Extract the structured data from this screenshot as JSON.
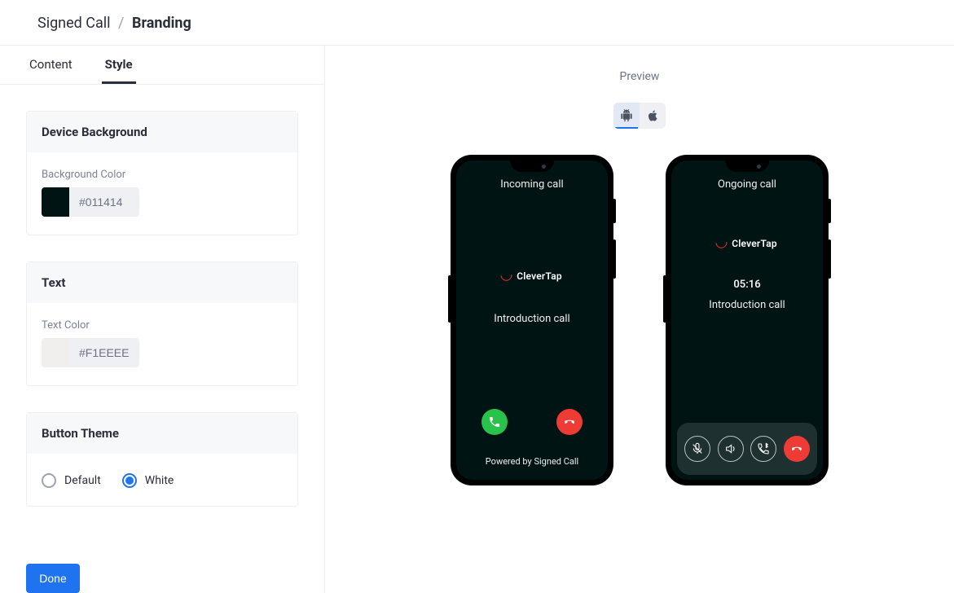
{
  "breadcrumb": {
    "parent": "Signed Call",
    "sep": "/",
    "leaf": "Branding"
  },
  "tabs": {
    "content": "Content",
    "style": "Style"
  },
  "cards": {
    "bg": {
      "title": "Device Background",
      "label": "Background Color",
      "value": "#011414"
    },
    "text": {
      "title": "Text",
      "label": "Text Color",
      "value": "#F1EEEE"
    },
    "btn": {
      "title": "Button Theme",
      "opt0": "Default",
      "opt1": "White"
    }
  },
  "done": "Done",
  "preview": {
    "label": "Preview"
  },
  "brand": {
    "name": "CleverTap"
  },
  "incoming": {
    "status": "Incoming call",
    "context": "Introduction call",
    "powered": "Powered by Signed Call"
  },
  "ongoing": {
    "status": "Ongoing call",
    "timer": "05:16",
    "context": "Introduction call"
  },
  "colors": {
    "deviceBg": "#011414",
    "deviceText": "#F1EEEE"
  }
}
